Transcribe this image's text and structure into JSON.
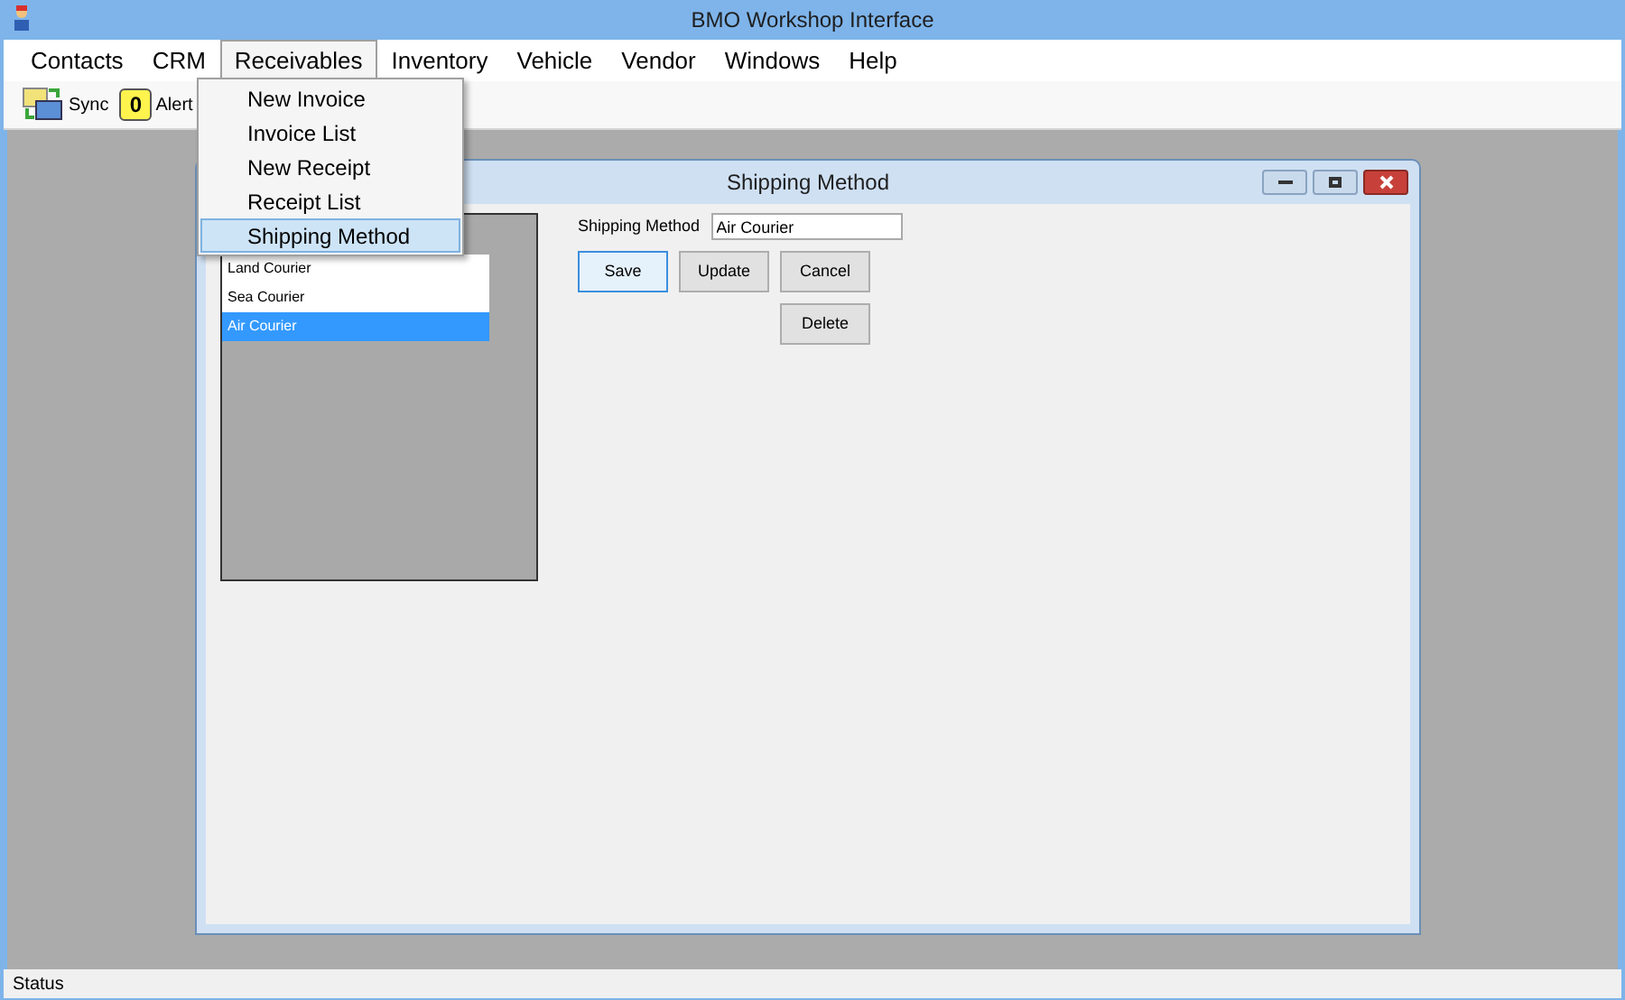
{
  "window": {
    "title": "BMO Workshop Interface"
  },
  "menu_bar": [
    {
      "label": "Contacts",
      "selected": false
    },
    {
      "label": "CRM",
      "selected": false
    },
    {
      "label": "Receivables",
      "selected": true
    },
    {
      "label": "Inventory",
      "selected": false
    },
    {
      "label": "Vehicle",
      "selected": false
    },
    {
      "label": "Vendor",
      "selected": false
    },
    {
      "label": "Windows",
      "selected": false
    },
    {
      "label": "Help",
      "selected": false
    }
  ],
  "toolbar": [
    {
      "kind": "sync",
      "label": "Sync"
    },
    {
      "kind": "alert",
      "badge": "0",
      "label": "Alert"
    }
  ],
  "dropdown_menu": [
    {
      "label": "New Invoice",
      "selected": false
    },
    {
      "label": "Invoice List",
      "selected": false
    },
    {
      "label": "New Receipt",
      "selected": false
    },
    {
      "label": "Receipt List",
      "selected": false
    },
    {
      "label": "Shipping Method",
      "selected": true
    }
  ],
  "child_window": {
    "title": "Shipping Method",
    "list": [
      {
        "label": "Land Courier",
        "selected": false
      },
      {
        "label": "Sea Courier",
        "selected": false
      },
      {
        "label": "Air Courier",
        "selected": true
      }
    ],
    "field": {
      "label": "Shipping Method",
      "value": "Air Courier"
    },
    "buttons": [
      {
        "label": "Save",
        "focused": true
      },
      {
        "label": "Update",
        "focused": false
      },
      {
        "label": "Cancel",
        "focused": false
      },
      {
        "label": "Delete",
        "focused": false
      }
    ]
  },
  "status_bar": {
    "text": "Status"
  }
}
